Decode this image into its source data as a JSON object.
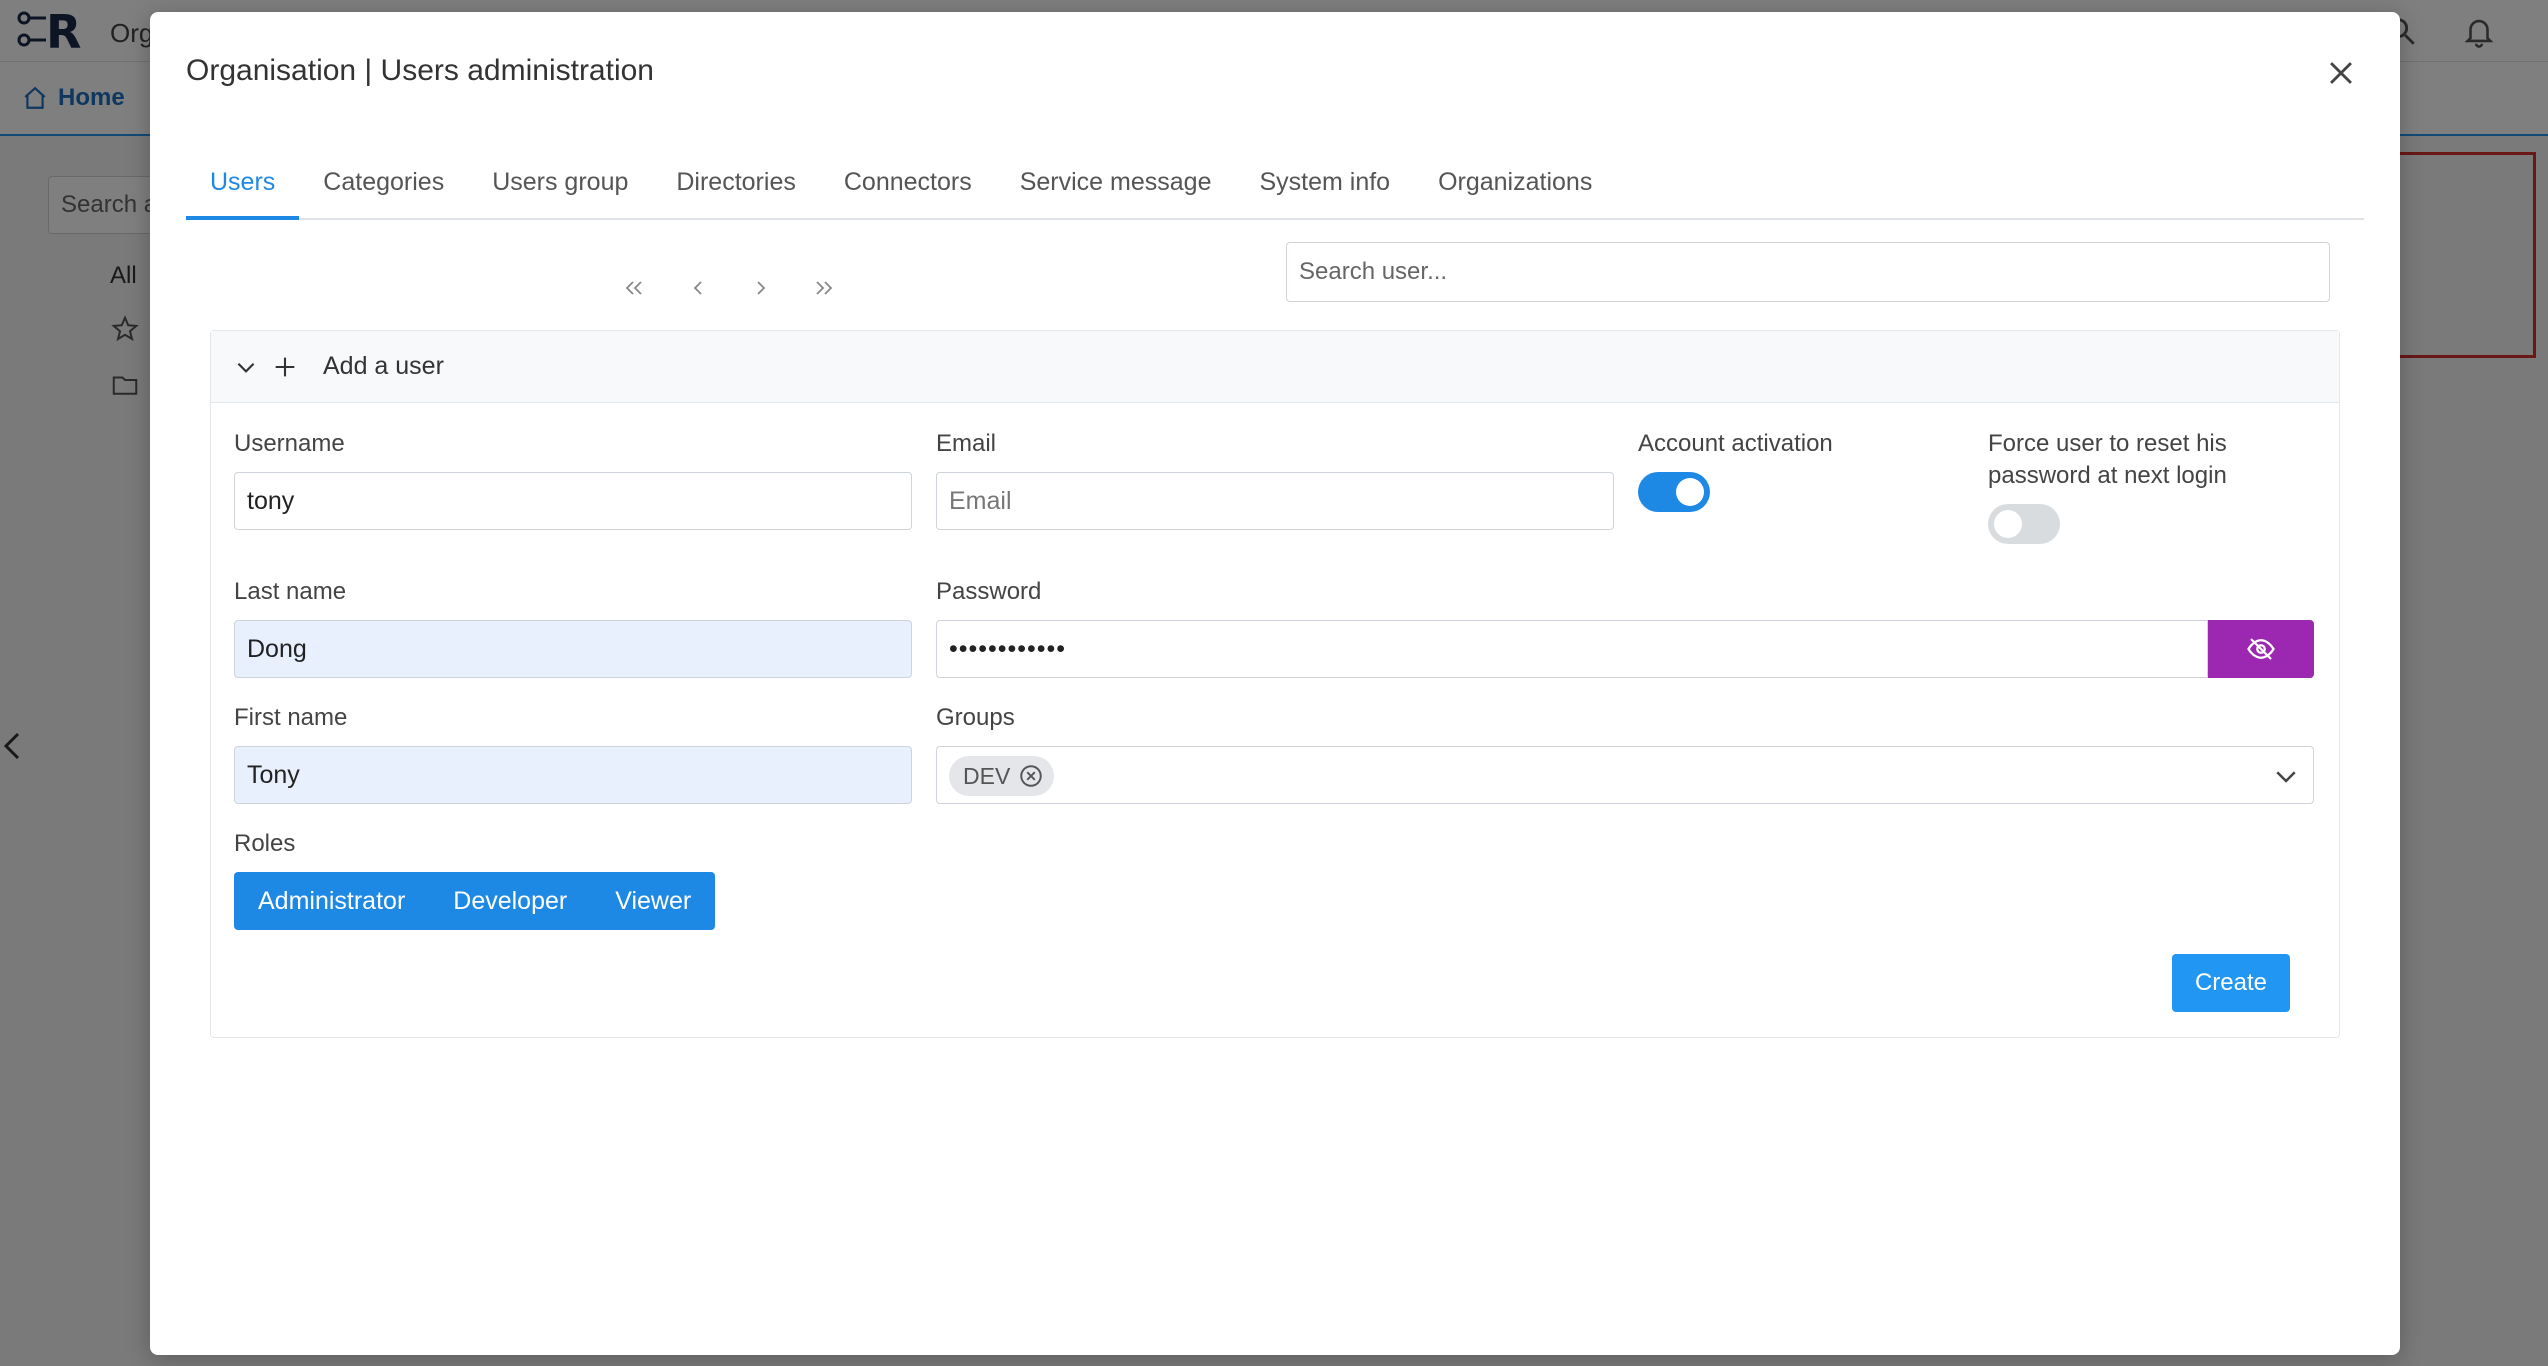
{
  "background": {
    "app_title": "Org",
    "home_label": "Home",
    "search_placeholder": "Search a",
    "all_label": "All"
  },
  "modal": {
    "title": "Organisation | Users administration",
    "tabs": [
      {
        "label": "Users",
        "active": true
      },
      {
        "label": "Categories"
      },
      {
        "label": "Users group"
      },
      {
        "label": "Directories"
      },
      {
        "label": "Connectors"
      },
      {
        "label": "Service message"
      },
      {
        "label": "System info"
      },
      {
        "label": "Organizations"
      }
    ],
    "search_user_placeholder": "Search user...",
    "add_user": {
      "header_label": "Add a user",
      "username_label": "Username",
      "username_value": "tony",
      "email_label": "Email",
      "email_placeholder": "Email",
      "account_activation_label": "Account activation",
      "account_activation_on": true,
      "force_reset_label_line1": "Force user to reset his",
      "force_reset_label_line2": "password at next login",
      "force_reset_on": false,
      "lastname_label": "Last name",
      "lastname_value": "Dong",
      "password_label": "Password",
      "password_value": "••••••••••••",
      "firstname_label": "First name",
      "firstname_value": "Tony",
      "groups_label": "Groups",
      "groups_selected": [
        "DEV"
      ],
      "roles_label": "Roles",
      "roles": [
        "Administrator",
        "Developer",
        "Viewer"
      ],
      "create_label": "Create"
    }
  },
  "colors": {
    "accent": "#1e88e5",
    "eye_button": "#9c27b0",
    "filled_input": "#e8f0fe"
  }
}
